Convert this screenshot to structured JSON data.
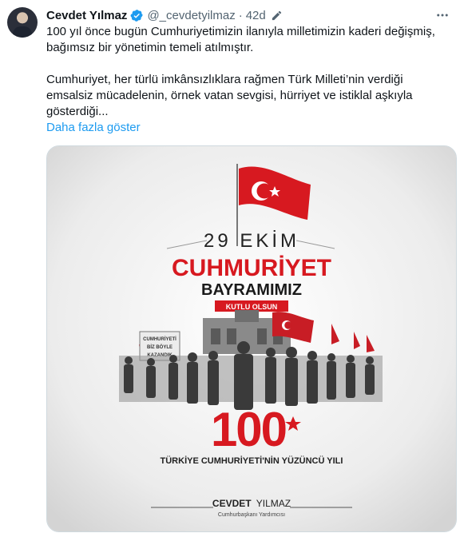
{
  "author": {
    "name": "Cevdet Yılmaz",
    "handle": "@_cevdetyilmaz",
    "separator": "·",
    "time": "42d"
  },
  "icons": {
    "verified": "verified-badge-icon",
    "edit": "pencil-edit-icon",
    "more": "more-dots-icon"
  },
  "tweet": {
    "line1": "100 yıl önce bugün Cumhuriyetimizin ilanıyla milletimizin kaderi değişmiş,",
    "line2": "bağımsız bir yönetimin temeli atılmıştır.",
    "line3": "Cumhuriyet, her türlü imkânsızlıklara rağmen Türk Milleti’nin verdiği",
    "line4": "emsalsiz mücadelenin, örnek vatan sevgisi, hürriyet ve istiklal aşkıyla",
    "line5": "gösterdiği...",
    "show_more": "Daha fazla göster"
  },
  "poster": {
    "date": "29 EKİM",
    "title1": "CUHMURİYET",
    "title2": "BAYRAMIMIZ",
    "ribbon": "KUTLU OLSUN",
    "sign_line1": "CUMHURİYETİ",
    "sign_line2": "BİZ BÖYLE",
    "sign_line3": "KAZANDIK",
    "number": "100",
    "subtitle": "TÜRKİYE CUMHURİYETİ'NİN YÜZÜNCÜ YILI",
    "signature_first": "CEVDET",
    "signature_last": "YILMAZ",
    "signature_role": "Cumhurbaşkanı Yardımcısı"
  },
  "colors": {
    "accent_link": "#1d9bf0",
    "verified": "#1d9bf0",
    "flag_red": "#d71920",
    "text_muted": "#536471"
  }
}
